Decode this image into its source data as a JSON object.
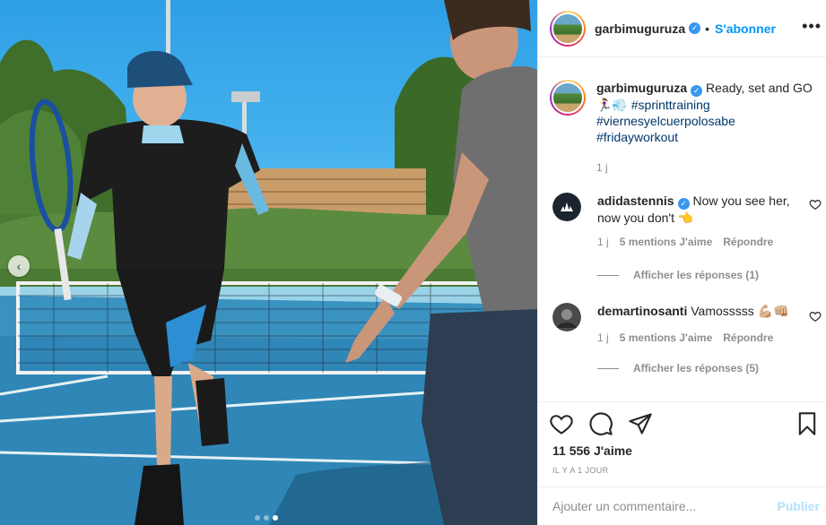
{
  "post": {
    "author": "garbimuguruza",
    "verified_label": "✓",
    "separator": "•",
    "follow_label": "S'abonner",
    "more_label": "•••",
    "caption": {
      "main": "Ready, set and GO",
      "emoji_line": "🏃‍♀️💨",
      "tags": [
        "#sprinttraining",
        "#viernesyelcuerpolosabe",
        "#fridayworkout"
      ],
      "time": "1 j"
    },
    "carousel": {
      "count": 3,
      "active_index": 2,
      "prev_label": "‹"
    }
  },
  "comments": [
    {
      "user": "adidastennis",
      "verified": true,
      "text": "Now you see her, now you don't 👈",
      "time": "1 j",
      "likes": "5 mentions J'aime",
      "reply_label": "Répondre",
      "view_replies": "Afficher les réponses (1)"
    },
    {
      "user": "demartinosanti",
      "verified": false,
      "text": "Vamosssss 💪🏼👊🏼",
      "time": "1 j",
      "likes": "5 mentions J'aime",
      "reply_label": "Répondre",
      "view_replies": "Afficher les réponses (5)"
    }
  ],
  "actions": {
    "likes_count": "11 556 J'aime",
    "posted_ago": "IL Y A 1 JOUR"
  },
  "composer": {
    "placeholder": "Ajouter un commentaire...",
    "publish_label": "Publier"
  },
  "colors": {
    "link_blue": "#0095f6",
    "hashtag": "#00376b",
    "muted": "#8e8e8e",
    "publish_disabled": "#b2dffc"
  }
}
